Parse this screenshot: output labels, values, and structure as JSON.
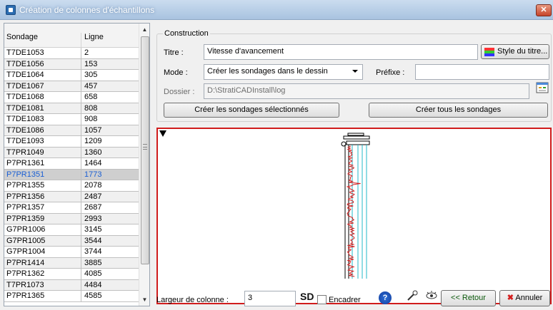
{
  "window": {
    "title": "Création de colonnes d'échantillons",
    "close": "✕"
  },
  "list": {
    "headers": {
      "sondage": "Sondage",
      "ligne": "Ligne"
    },
    "rows": [
      {
        "sondage": "T7DE1053",
        "ligne": "2"
      },
      {
        "sondage": "T7DE1056",
        "ligne": "153"
      },
      {
        "sondage": "T7DE1064",
        "ligne": "305"
      },
      {
        "sondage": "T7DE1067",
        "ligne": "457"
      },
      {
        "sondage": "T7DE1068",
        "ligne": "658"
      },
      {
        "sondage": "T7DE1081",
        "ligne": "808"
      },
      {
        "sondage": "T7DE1083",
        "ligne": "908"
      },
      {
        "sondage": "T7DE1086",
        "ligne": "1057"
      },
      {
        "sondage": "T7DE1093",
        "ligne": "1209"
      },
      {
        "sondage": "T7PR1049",
        "ligne": "1360"
      },
      {
        "sondage": "P7PR1361",
        "ligne": "1464"
      },
      {
        "sondage": "P7PR1351",
        "ligne": "1773",
        "selected": true
      },
      {
        "sondage": "P7PR1355",
        "ligne": "2078"
      },
      {
        "sondage": "P7PR1356",
        "ligne": "2487"
      },
      {
        "sondage": "P7PR1357",
        "ligne": "2687"
      },
      {
        "sondage": "P7PR1359",
        "ligne": "2993"
      },
      {
        "sondage": "G7PR1006",
        "ligne": "3145"
      },
      {
        "sondage": "G7PR1005",
        "ligne": "3544"
      },
      {
        "sondage": "G7PR1004",
        "ligne": "3744"
      },
      {
        "sondage": "P7PR1414",
        "ligne": "3885"
      },
      {
        "sondage": "P7PR1362",
        "ligne": "4085"
      },
      {
        "sondage": "T7PR1073",
        "ligne": "4484"
      },
      {
        "sondage": "P7PR1365",
        "ligne": "4585"
      }
    ]
  },
  "construction": {
    "group_label": "Construction",
    "titre_label": "Titre :",
    "titre_value": "Vitesse d'avancement",
    "style_button": "Style du titre...",
    "mode_label": "Mode :",
    "mode_value": "Créer les sondages dans le dessin",
    "prefixe_label": "Préfixe :",
    "prefixe_value": "",
    "dossier_label": "Dossier :",
    "dossier_value": "D:\\StratiCADInstall\\log",
    "btn_selected": "Créer les sondages sélectionnés",
    "btn_all": "Créer tous les sondages"
  },
  "bottom": {
    "largeur_label": "Largeur de colonne :",
    "largeur_value": "3",
    "sd_icon": "SD",
    "encadrer_label": "Encadrer",
    "help_icon": "?",
    "back_label": "<< Retour",
    "cancel_label": "Annuler"
  },
  "colors": {
    "preview_border": "#d01c1c",
    "selected_text": "#1a5fd4",
    "log_red": "#d42020",
    "log_cyan": "#20b8c8"
  }
}
